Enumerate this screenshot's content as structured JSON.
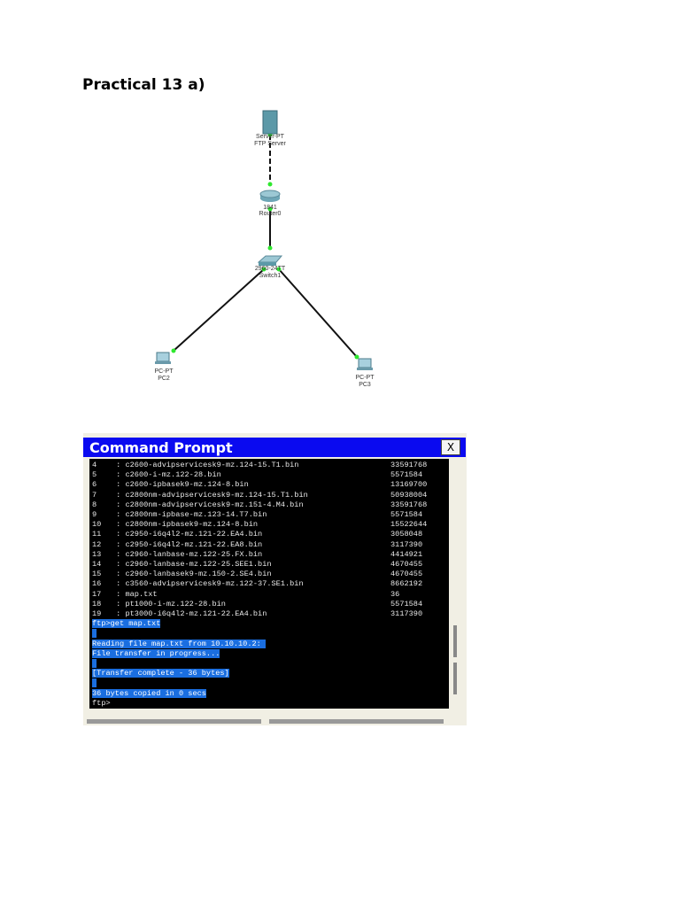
{
  "heading": "Practical 13 a)",
  "diagram": {
    "server": {
      "model": "Server-PT",
      "name": "FTP Server"
    },
    "router": {
      "model": "1841",
      "name": "Router0"
    },
    "switch": {
      "model": "2960-24TT",
      "name": "Switch1"
    },
    "pc2": {
      "model": "PC-PT",
      "name": "PC2"
    },
    "pc3": {
      "model": "PC-PT",
      "name": "PC3"
    }
  },
  "command_prompt": {
    "title": "Command Prompt",
    "close_label": "X",
    "files": [
      {
        "n": "4",
        "name": "c2600-advipservicesk9-mz.124-15.T1.bin",
        "size": "33591768"
      },
      {
        "n": "5",
        "name": "c2600-i-mz.122-28.bin",
        "size": "5571584"
      },
      {
        "n": "6",
        "name": "c2600-ipbasek9-mz.124-8.bin",
        "size": "13169700"
      },
      {
        "n": "7",
        "name": "c2800nm-advipservicesk9-mz.124-15.T1.bin",
        "size": "50938004"
      },
      {
        "n": "8",
        "name": "c2800nm-advipservicesk9-mz.151-4.M4.bin",
        "size": "33591768"
      },
      {
        "n": "9",
        "name": "c2800nm-ipbase-mz.123-14.T7.bin",
        "size": "5571584"
      },
      {
        "n": "10",
        "name": "c2800nm-ipbasek9-mz.124-8.bin",
        "size": "15522644"
      },
      {
        "n": "11",
        "name": "c2950-i6q4l2-mz.121-22.EA4.bin",
        "size": "3058048"
      },
      {
        "n": "12",
        "name": "c2950-i6q4l2-mz.121-22.EA8.bin",
        "size": "3117390"
      },
      {
        "n": "13",
        "name": "c2960-lanbase-mz.122-25.FX.bin",
        "size": "4414921"
      },
      {
        "n": "14",
        "name": "c2960-lanbase-mz.122-25.SEE1.bin",
        "size": "4670455"
      },
      {
        "n": "15",
        "name": "c2960-lanbasek9-mz.150-2.SE4.bin",
        "size": "4670455"
      },
      {
        "n": "16",
        "name": "c3560-advipservicesk9-mz.122-37.SE1.bin",
        "size": "8662192"
      },
      {
        "n": "17",
        "name": "map.txt",
        "size": "36"
      },
      {
        "n": "18",
        "name": "pt1000-i-mz.122-28.bin",
        "size": "5571584"
      },
      {
        "n": "19",
        "name": "pt3000-i6q4l2-mz.121-22.EA4.bin",
        "size": "3117390"
      }
    ],
    "output": [
      "ftp>get map.txt",
      "",
      "Reading file map.txt from 10.10.10.2: ",
      "File transfer in progress...",
      "",
      "[Transfer complete - 36 bytes]",
      "",
      "36 bytes copied in 0 secs",
      "ftp>"
    ]
  }
}
